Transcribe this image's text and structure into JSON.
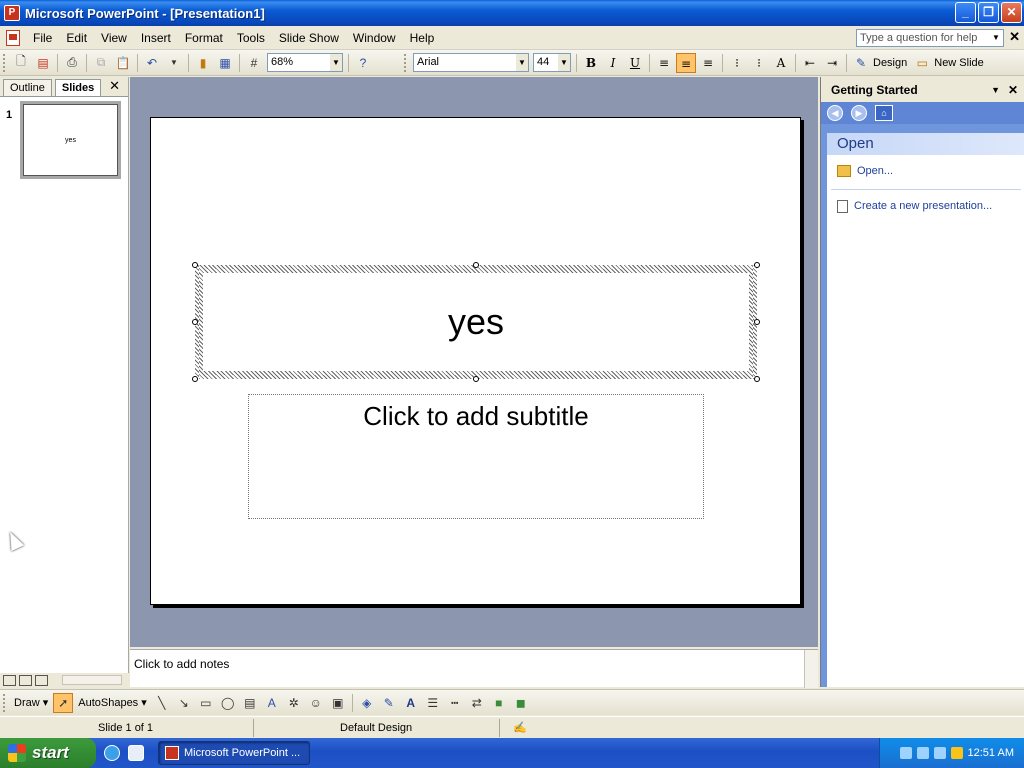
{
  "window": {
    "title": "Microsoft PowerPoint - [Presentation1]",
    "buttons": {
      "minimize": "_",
      "restore": "❐",
      "close": "✕"
    }
  },
  "menu": {
    "items": [
      "File",
      "Edit",
      "View",
      "Insert",
      "Format",
      "Tools",
      "Slide Show",
      "Window",
      "Help"
    ],
    "help_placeholder": "Type a question for help"
  },
  "toolbar": {
    "zoom": "68%",
    "font": "Arial",
    "font_size": "44",
    "bold": "B",
    "italic": "I",
    "underline": "U",
    "design_label": "Design",
    "new_slide_label": "New Slide",
    "active_alignment": "center"
  },
  "left_pane": {
    "tabs": [
      "Outline",
      "Slides"
    ],
    "active_tab": "Slides",
    "slides": [
      {
        "number": "1",
        "title": "yes"
      }
    ]
  },
  "slide": {
    "title": "yes",
    "subtitle_placeholder": "Click to add subtitle"
  },
  "notes": {
    "placeholder": "Click to add notes"
  },
  "task_pane": {
    "title": "Getting Started",
    "section": "Open",
    "links": [
      "Open...",
      "Create a new presentation..."
    ]
  },
  "drawing_toolbar": {
    "draw_label": "Draw",
    "autoshapes_label": "AutoShapes"
  },
  "status_bar": {
    "slide_info": "Slide 1 of 1",
    "design": "Default Design"
  },
  "taskbar": {
    "start_label": "start",
    "task_item": "Microsoft PowerPoint ...",
    "clock": "12:51 AM"
  },
  "colors": {
    "title_bar": "#0b5bd4",
    "slide_area_bg": "#8c96ae",
    "task_pane_bg": "#6f95dc",
    "active_button": "#ffc36a"
  }
}
